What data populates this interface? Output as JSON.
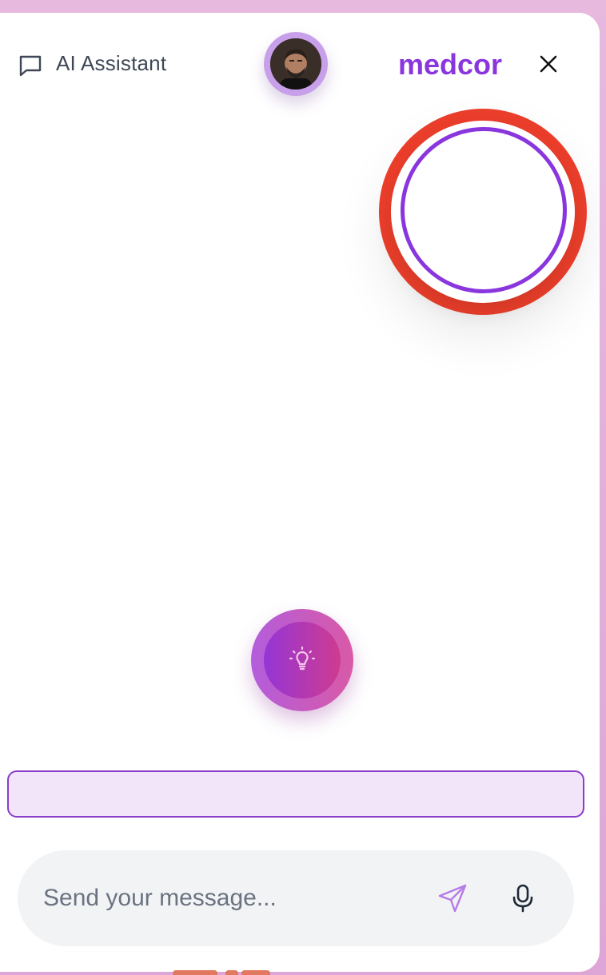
{
  "header": {
    "title": "AI Assistant",
    "title_icon": "chat-bubble-icon",
    "brand": "medcor",
    "close_icon": "close-icon",
    "avatar_label": "user-avatar"
  },
  "voice_orb": {
    "outer_color": "#ea3e2b",
    "ring_color": "#8a36de"
  },
  "idea_button": {
    "icon": "lightbulb-icon"
  },
  "composer": {
    "placeholder": "Send your message...",
    "value": "",
    "send_icon": "send-icon",
    "mic_icon": "microphone-icon"
  },
  "colors": {
    "accent": "#8a36de",
    "brand": "#8a36de",
    "background_frame": "#e7b9df",
    "suggestion_fill": "#f2e5fa",
    "composer_fill": "#f2f3f5"
  }
}
